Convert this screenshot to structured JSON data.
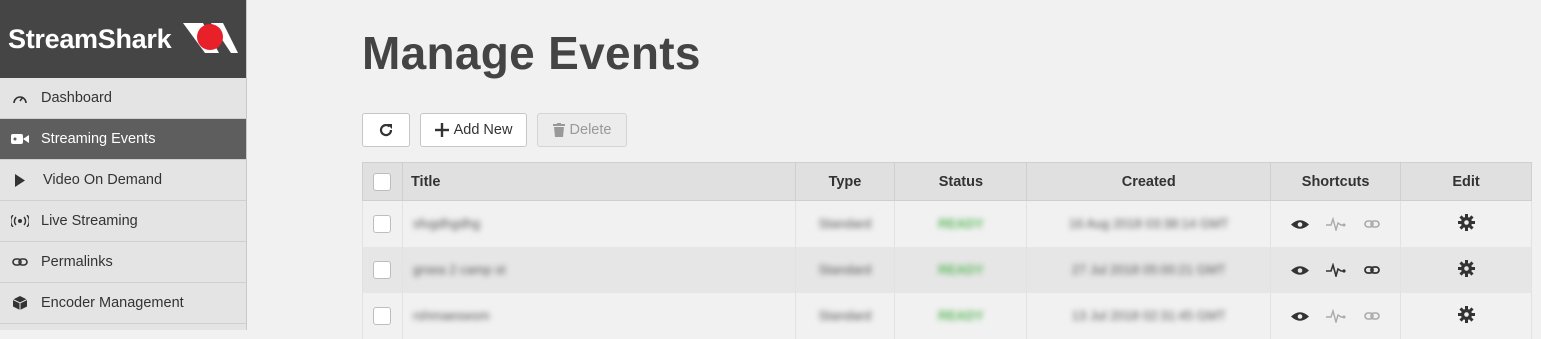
{
  "brand": {
    "name": "StreamShark"
  },
  "sidebar": {
    "items": [
      {
        "label": "Dashboard",
        "icon": "gauge-icon",
        "active": false
      },
      {
        "label": "Streaming Events",
        "icon": "video-camera-icon",
        "active": true
      },
      {
        "label": "Video On Demand",
        "icon": "play-icon",
        "active": false
      },
      {
        "label": "Live Streaming",
        "icon": "broadcast-icon",
        "active": false
      },
      {
        "label": "Permalinks",
        "icon": "link-icon",
        "active": false
      },
      {
        "label": "Encoder Management",
        "icon": "cube-icon",
        "active": false
      }
    ]
  },
  "page": {
    "title": "Manage Events"
  },
  "toolbar": {
    "refresh_icon": "refresh-icon",
    "add_label": "Add New",
    "delete_label": "Delete"
  },
  "table": {
    "headers": {
      "title": "Title",
      "type": "Type",
      "status": "Status",
      "created": "Created",
      "shortcuts": "Shortcuts",
      "edit": "Edit"
    },
    "rows": [
      {
        "title": "sfvgdhgdhg",
        "type": "Standard",
        "status": "READY",
        "created": "16 Aug 2018 03:38:14 GMT"
      },
      {
        "title": "grsea 2 camp st",
        "type": "Standard",
        "status": "READY",
        "created": "27 Jul 2018 05:00:21 GMT"
      },
      {
        "title": "rshmaeswsm",
        "type": "Standard",
        "status": "READY",
        "created": "13 Jul 2018 02:31:45 GMT"
      }
    ]
  },
  "colors": {
    "sidebar_active": "#5e5e5e",
    "brand_bg": "#454545",
    "status_green": "#5cb85c",
    "logo_red": "#e8202a"
  }
}
